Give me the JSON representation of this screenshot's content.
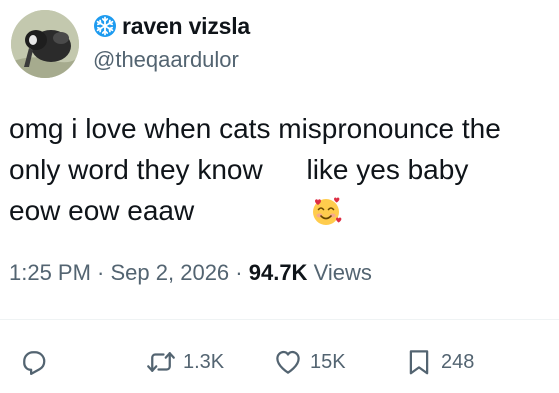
{
  "user": {
    "display_name": "raven vizsla",
    "handle": "@theqaardulor",
    "badge_icon": "snowflake-icon",
    "avatar_icon": "bird-photo"
  },
  "tweet": {
    "line1": "omg i love when cats mispronounce the",
    "line2_before": "only word they know",
    "line2_emoji": "smiling-face-with-hearts-emoji",
    "line2_after": " like yes baby",
    "line3": "eow eow eaaw"
  },
  "meta": {
    "time": "1:25 PM",
    "separator": " · ",
    "date": "Sep 2, 2026",
    "views_count": "94.7K",
    "views_label": " Views"
  },
  "actions": {
    "reply_count": "",
    "retweet_count": "1.3K",
    "like_count": "15K",
    "bookmark_count": "248"
  },
  "colors": {
    "text_primary": "#0f1419",
    "text_secondary": "#536471",
    "divider": "#eff3f4",
    "badge_blue": "#1d9bf0"
  }
}
